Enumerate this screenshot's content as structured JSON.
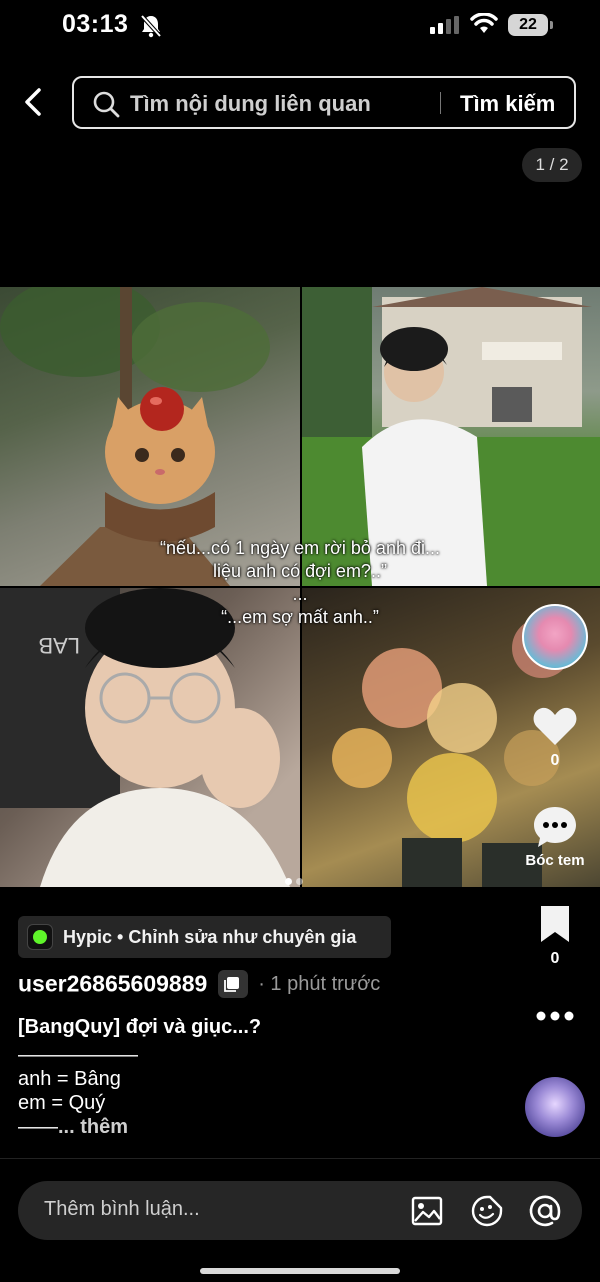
{
  "status_bar": {
    "time": "03:13",
    "battery": "22"
  },
  "search": {
    "placeholder": "Tìm nội dung liên quan",
    "button_label": "Tìm kiếm"
  },
  "gallery": {
    "page_counter": "1 / 2",
    "caption_lines": [
      "“nếu...có 1 ngày em rời bỏ anh đi...",
      "liệu anh có đợi em?..”",
      "...",
      "“...em sợ mất anh..”"
    ],
    "current_dot": 1,
    "dot_count": 2
  },
  "actions": {
    "like_count": "0",
    "comment_label": "Bóc tem",
    "bookmark_count": "0"
  },
  "post": {
    "app_chip": "Hypic • Chỉnh sửa như chuyên gia",
    "username": "user26865609889",
    "time_ago": "· 1 phút trước",
    "title": "[BangQuy] đợi và giục...?",
    "body_lines": [
      "——————",
      "anh = Bâng",
      "em = Quý"
    ],
    "body_last_prefix": "——",
    "more_label": "... thêm"
  },
  "comment_bar": {
    "placeholder": "Thêm bình luận..."
  },
  "colors": {
    "background": "#000000",
    "chip_bg": "#262626",
    "app_logo": "#5ff52a"
  }
}
